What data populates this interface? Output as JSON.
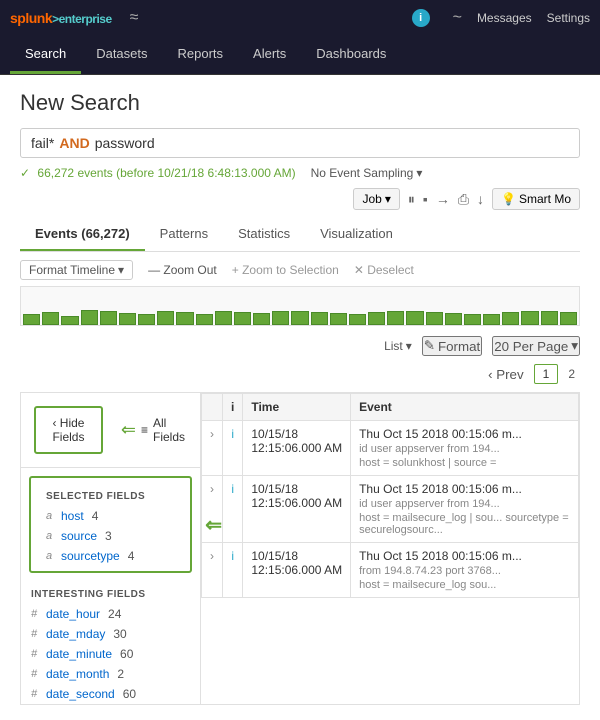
{
  "app": {
    "logo": "splunk",
    "logo_suffix": ">enterprise",
    "activity_icon": "≈",
    "info_label": "i",
    "activity2_icon": "~",
    "messages_label": "Messages",
    "settings_label": "Settings"
  },
  "main_nav": {
    "items": [
      {
        "label": "Search",
        "active": true
      },
      {
        "label": "Datasets",
        "active": false
      },
      {
        "label": "Reports",
        "active": false
      },
      {
        "label": "Alerts",
        "active": false
      },
      {
        "label": "Dashboards",
        "active": false
      }
    ]
  },
  "page": {
    "title": "New Search"
  },
  "search": {
    "query_part1": "fail*",
    "operator": "AND",
    "query_part2": "password"
  },
  "status": {
    "check": "✓",
    "events_text": "66,272 events (before 10/21/18 6:48:13.000 AM)",
    "sampling_label": "No Event Sampling",
    "sampling_arrow": "▾"
  },
  "toolbar": {
    "job_label": "Job",
    "job_arrow": "▾",
    "pause_icon": "⏸",
    "stop_icon": "▪",
    "send_icon": "→",
    "print_icon": "⎙",
    "download_icon": "↓",
    "smart_label": "Smart Mo"
  },
  "tabs": [
    {
      "label": "Events (66,272)",
      "active": true
    },
    {
      "label": "Patterns",
      "active": false
    },
    {
      "label": "Statistics",
      "active": false
    },
    {
      "label": "Visualization",
      "active": false
    }
  ],
  "timeline": {
    "format_label": "Format Timeline",
    "format_arrow": "▾",
    "zoom_out_label": "— Zoom Out",
    "zoom_selection_label": "+ Zoom to Selection",
    "deselect_label": "✕ Deselect",
    "bars": [
      30,
      35,
      25,
      40,
      38,
      32,
      28,
      36,
      34,
      30,
      38,
      35,
      32,
      38,
      36,
      34,
      32,
      30,
      35,
      38,
      36,
      34,
      32,
      30,
      28,
      35,
      38,
      36,
      34
    ]
  },
  "list_controls": {
    "list_label": "List",
    "list_arrow": "▾",
    "pencil_icon": "✎",
    "format_label": "Format",
    "perpage_label": "20 Per Page",
    "perpage_arrow": "▾"
  },
  "pagination": {
    "prev_label": "‹ Prev",
    "current_page": "1",
    "next_page": "2"
  },
  "sidebar": {
    "hide_fields_label": "‹ Hide Fields",
    "all_fields_icon": "≡",
    "all_fields_label": "All Fields",
    "selected_section_title": "SELECTED FIELDS",
    "selected_fields": [
      {
        "type": "a",
        "name": "host",
        "count": "4"
      },
      {
        "type": "a",
        "name": "source",
        "count": "3"
      },
      {
        "type": "a",
        "name": "sourcetype",
        "count": "4"
      }
    ],
    "interesting_section_title": "INTERESTING FIELDS",
    "interesting_fields": [
      {
        "type": "#",
        "name": "date_hour",
        "count": "24"
      },
      {
        "type": "#",
        "name": "date_mday",
        "count": "30"
      },
      {
        "type": "#",
        "name": "date_minute",
        "count": "60"
      },
      {
        "type": "#",
        "name": "date_month",
        "count": "2"
      },
      {
        "type": "#",
        "name": "date_second",
        "count": "60"
      }
    ]
  },
  "events_table": {
    "columns": [
      {
        "key": "expand",
        "label": ""
      },
      {
        "key": "info",
        "label": "i"
      },
      {
        "key": "time",
        "label": "Time"
      },
      {
        "key": "event",
        "label": "Event"
      }
    ],
    "rows": [
      {
        "time": "10/15/18\n12:15:06.000 AM",
        "event_main": "Thu Oct 15 2018 00:15:06 m...",
        "event_meta": "id user appserver from 194...",
        "event_detail": "host = solunkhost | source ="
      },
      {
        "time": "10/15/18\n12:15:06.000 AM",
        "event_main": "Thu Oct 15 2018 00:15:06 m...",
        "event_meta": "id user appserver from 194...",
        "event_detail": "host = mailsecure_log | sou... sourcetype = securelogsourc..."
      },
      {
        "time": "10/15/18\n12:15:06.000 AM",
        "event_main": "Thu Oct 15 2018 00:15:06 m...",
        "event_meta": "from 194.8.74.23 port 3768...",
        "event_detail": "host = mailsecure_log  sou..."
      }
    ]
  }
}
